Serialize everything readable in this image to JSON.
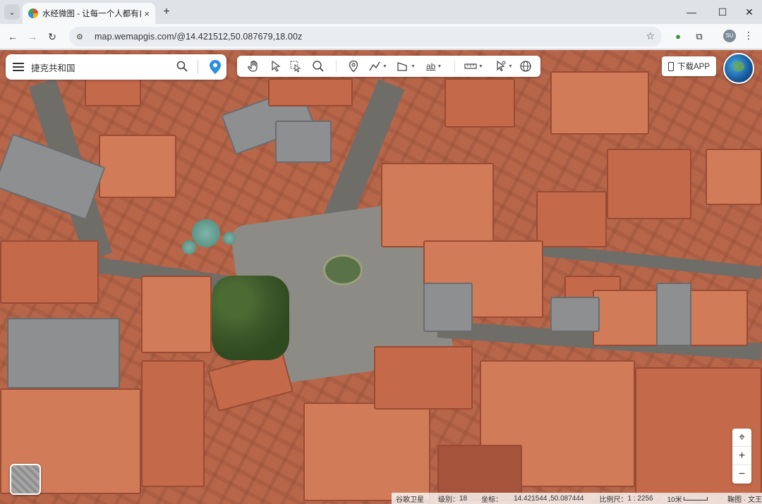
{
  "browser": {
    "tab_title": "水经微图 - 让每一个人都有自己",
    "tab_close": "×",
    "new_tab": "+",
    "tab_menu": "⌄",
    "url": "map.wemapgis.com/@14.421512,50.087679,18.00z",
    "window_controls": {
      "minimize": "—",
      "maximize": "☐",
      "close": "✕"
    },
    "nav": {
      "back": "←",
      "forward": "→",
      "reload": "↻"
    },
    "profile_initials": "SU",
    "icons": [
      "tab-list-icon",
      "back-icon",
      "forward-icon",
      "reload-icon",
      "site-settings-icon",
      "bookmark-star-icon",
      "extension-icon",
      "puzzle-icon",
      "profile-avatar",
      "menu-kebab-icon"
    ]
  },
  "search": {
    "value": "捷克共和国"
  },
  "toolbar": {
    "tools": [
      "pan-hand-icon",
      "pointer-icon",
      "select-box-icon",
      "zoom-search-icon",
      "marker-icon",
      "polyline-icon",
      "polygon-icon",
      "text-label-icon",
      "ruler-icon",
      "cursor-tools-icon",
      "globe-icon"
    ],
    "text_tool_label": "ab"
  },
  "download_app": {
    "label": "下载APP"
  },
  "zoom": {
    "locate": "⌖",
    "in": "+",
    "out": "−"
  },
  "status": {
    "source": "谷歌卫星",
    "level_label": "级别：",
    "level": "18",
    "coord_label": "坐标：",
    "lng": "14.421544",
    "lat": "50.087444",
    "ratio_label": "比例尺：",
    "ratio": "1 : 2256",
    "scale_label": "10米",
    "credit": "鞠图 · 文王"
  },
  "colors": {
    "accent_pin": "#2a8ee6",
    "browser_chrome": "#dfe3e8",
    "roof": "#c4694a"
  }
}
